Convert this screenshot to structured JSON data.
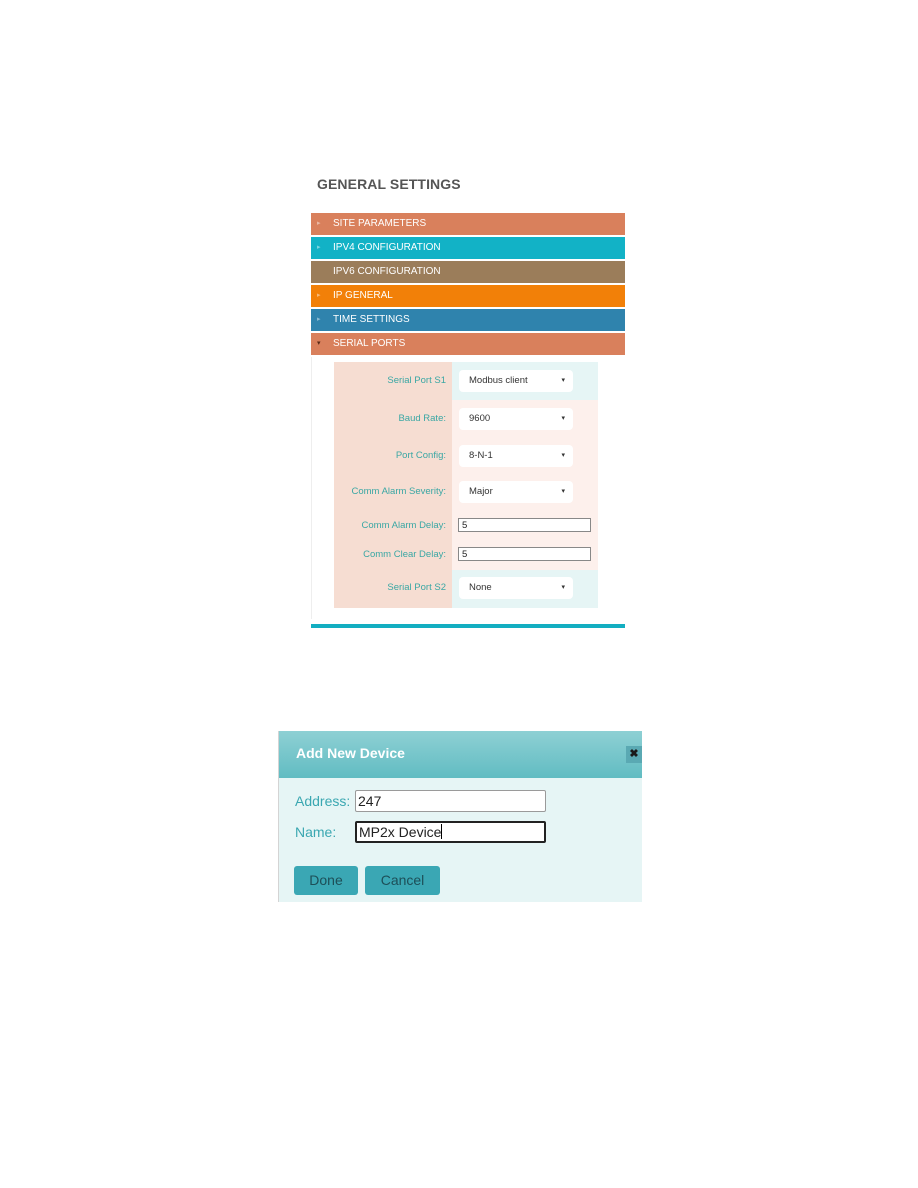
{
  "general_settings": {
    "title": "GENERAL SETTINGS",
    "sections": [
      {
        "label": "SITE PARAMETERS",
        "color": "#d9805c",
        "expanded": false,
        "caret": "▸"
      },
      {
        "label": "IPV4 CONFIGURATION",
        "color": "#12b2c6",
        "expanded": false,
        "caret": "▸"
      },
      {
        "label": "IPV6 CONFIGURATION",
        "color": "#9b7d5a",
        "expanded": false,
        "caret": ""
      },
      {
        "label": "IP GENERAL",
        "color": "#f28008",
        "expanded": false,
        "caret": "▸"
      },
      {
        "label": "TIME SETTINGS",
        "color": "#2f83ad",
        "expanded": false,
        "caret": "▸"
      },
      {
        "label": "SERIAL PORTS",
        "color": "#d9805c",
        "expanded": true,
        "caret": "▾"
      }
    ],
    "serial_ports": {
      "fields": [
        {
          "label": "Serial Port S1",
          "type": "select",
          "value": "Modbus client"
        },
        {
          "label": "Baud Rate:",
          "type": "select",
          "value": "9600"
        },
        {
          "label": "Port Config:",
          "type": "select",
          "value": "8-N-1"
        },
        {
          "label": "Comm Alarm Severity:",
          "type": "select",
          "value": "Major"
        },
        {
          "label": "Comm Alarm Delay:",
          "type": "text",
          "value": "5"
        },
        {
          "label": "Comm Clear Delay:",
          "type": "text",
          "value": "5"
        },
        {
          "label": "Serial Port S2",
          "type": "select",
          "value": "None"
        }
      ],
      "dropdown_arrow": "▾"
    }
  },
  "add_device_dialog": {
    "title": "Add New Device",
    "close_icon": "✖",
    "address_label": "Address:",
    "address_value": "247",
    "name_label": "Name:",
    "name_value": "MP2x Device",
    "done_label": "Done",
    "cancel_label": "Cancel"
  }
}
